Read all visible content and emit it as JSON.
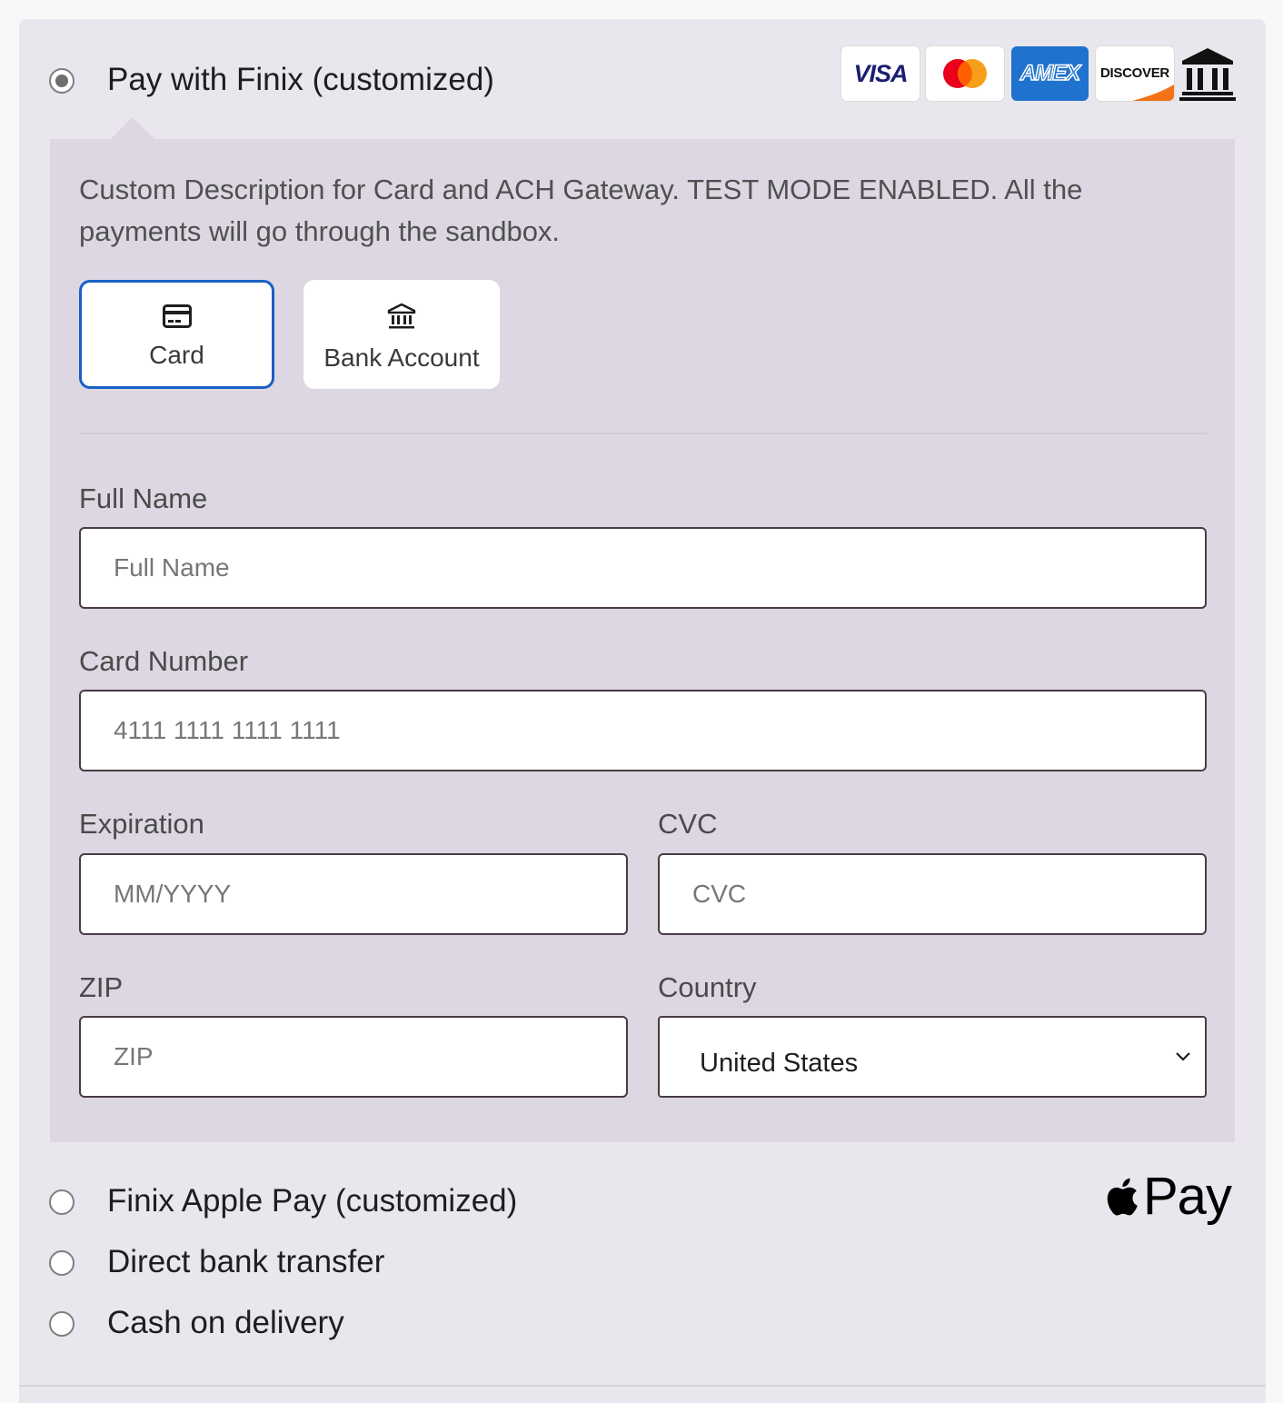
{
  "methods": {
    "finix": {
      "label": "Pay with Finix (customized)",
      "checked": true
    },
    "apple_pay": {
      "label": "Finix Apple Pay (customized)"
    },
    "bank_transfer": {
      "label": "Direct bank transfer"
    },
    "cod": {
      "label": "Cash on delivery"
    }
  },
  "brands": {
    "visa": "VISA",
    "amex": "AMEX",
    "discover": "DISCOVER"
  },
  "description": "Custom Description for Card and ACH Gateway. TEST MODE ENABLED. All the payments will go through the sandbox.",
  "tabs": {
    "card": {
      "label": "Card",
      "icon": "credit-card-icon"
    },
    "bank": {
      "label": "Bank Account",
      "icon": "bank-icon"
    }
  },
  "form": {
    "full_name": {
      "label": "Full Name",
      "placeholder": "Full Name"
    },
    "card_number": {
      "label": "Card Number",
      "placeholder": "4111 1111 1111 1111"
    },
    "expiration": {
      "label": "Expiration",
      "placeholder": "MM/YYYY"
    },
    "cvc": {
      "label": "CVC",
      "placeholder": "CVC"
    },
    "zip": {
      "label": "ZIP",
      "placeholder": "ZIP"
    },
    "country": {
      "label": "Country",
      "value": "United States"
    }
  },
  "apple_pay_mark": "Pay",
  "colors": {
    "accent": "#1a5fc6",
    "panel": "#dcd7e2",
    "background": "#e9e6ed",
    "amex": "#1f72cd",
    "discover_orange": "#f47216",
    "mastercard_red": "#eb001b",
    "mastercard_yellow": "#f79e1b"
  }
}
